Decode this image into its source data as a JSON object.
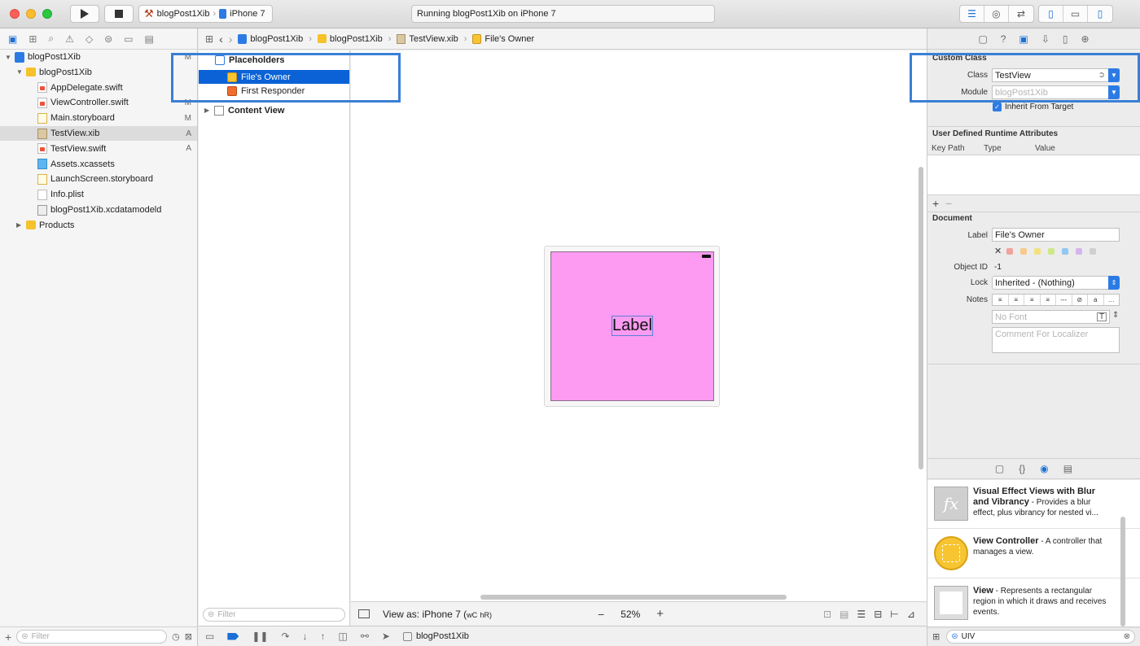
{
  "toolbar": {
    "scheme_target": "blogPost1Xib",
    "scheme_device": "iPhone 7",
    "status": "Running blogPost1Xib on iPhone 7"
  },
  "navigator": {
    "filter_placeholder": "Filter",
    "items": [
      {
        "label": "blogPost1Xib",
        "badge": "M",
        "kind": "proj",
        "level": 0,
        "disclosure": "▼"
      },
      {
        "label": "blogPost1Xib",
        "badge": "",
        "kind": "folder",
        "level": 1,
        "disclosure": "▼"
      },
      {
        "label": "AppDelegate.swift",
        "badge": "",
        "kind": "swift",
        "level": 2,
        "disclosure": ""
      },
      {
        "label": "ViewController.swift",
        "badge": "M",
        "kind": "swift",
        "level": 2,
        "disclosure": ""
      },
      {
        "label": "Main.storyboard",
        "badge": "M",
        "kind": "sb",
        "level": 2,
        "disclosure": ""
      },
      {
        "label": "TestView.xib",
        "badge": "A",
        "kind": "xib",
        "level": 2,
        "disclosure": "",
        "selected": true
      },
      {
        "label": "TestView.swift",
        "badge": "A",
        "kind": "swift",
        "level": 2,
        "disclosure": ""
      },
      {
        "label": "Assets.xcassets",
        "badge": "",
        "kind": "assets",
        "level": 2,
        "disclosure": ""
      },
      {
        "label": "LaunchScreen.storyboard",
        "badge": "",
        "kind": "sb",
        "level": 2,
        "disclosure": ""
      },
      {
        "label": "Info.plist",
        "badge": "",
        "kind": "plist",
        "level": 2,
        "disclosure": ""
      },
      {
        "label": "blogPost1Xib.xcdatamodeld",
        "badge": "",
        "kind": "xcd",
        "level": 2,
        "disclosure": ""
      },
      {
        "label": "Products",
        "badge": "",
        "kind": "folder",
        "level": 1,
        "disclosure": "▶"
      }
    ]
  },
  "jumpbar": {
    "crumbs": [
      "blogPost1Xib",
      "blogPost1Xib",
      "TestView.xib",
      "File's Owner"
    ]
  },
  "outline": {
    "placeholders": "Placeholders",
    "files_owner": "File's Owner",
    "first_responder": "First Responder",
    "content_view": "Content View",
    "filter_placeholder": "Filter"
  },
  "canvas": {
    "label_text": "Label",
    "view_as": "View as: iPhone 7 (",
    "w_size": "wC",
    "h_size": "hR)",
    "zoom": "52%"
  },
  "debugbar": {
    "target": "blogPost1Xib"
  },
  "inspector": {
    "custom_class_title": "Custom Class",
    "class_label": "Class",
    "class_value": "TestView",
    "module_label": "Module",
    "module_value": "blogPost1Xib",
    "inherit_label": "Inherit From Target",
    "udra_title": "User Defined Runtime Attributes",
    "col_key_path": "Key Path",
    "col_type": "Type",
    "col_value": "Value",
    "document_title": "Document",
    "doc_label_label": "Label",
    "doc_label_value": "File's Owner",
    "object_id_label": "Object ID",
    "object_id_value": "-1",
    "lock_label": "Lock",
    "lock_value": "Inherited - (Nothing)",
    "notes_label": "Notes",
    "font_placeholder": "No Font",
    "comment_placeholder": "Comment For Localizer",
    "swatch_colors": [
      "#f2a29c",
      "#f6c98c",
      "#f2e07e",
      "#cde88a",
      "#93c8f2",
      "#d6b4ee",
      "#cfcfcf"
    ]
  },
  "library": {
    "items": [
      {
        "title": "Visual Effect Views with Blur and Vibrancy",
        "desc": " - Provides a blur effect, plus vibrancy for nested vi..."
      },
      {
        "title": "View Controller",
        "desc": " - A controller that manages a view."
      },
      {
        "title": "View",
        "desc": " - Represents a rectangular region in which it draws and receives events."
      }
    ],
    "filter_value": "UIV"
  }
}
